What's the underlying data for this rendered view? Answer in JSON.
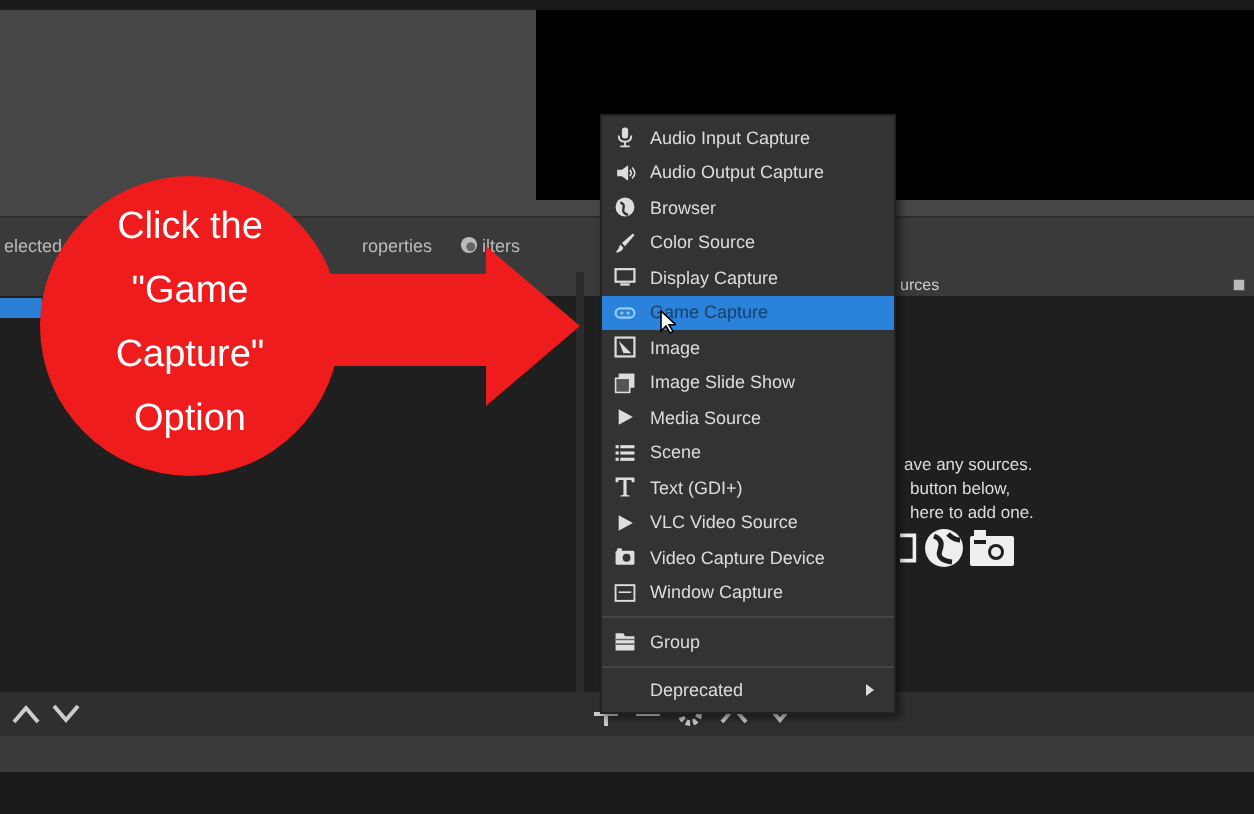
{
  "toolbar": {
    "selection_label": "elected",
    "properties_tab": "roperties",
    "filters_tab": "ilters"
  },
  "scenes": {
    "items": [
      {
        "selected": true
      }
    ]
  },
  "sources": {
    "title": "urces",
    "empty_message": [
      "ave any sources.",
      "button below,",
      "here to add one."
    ]
  },
  "menu": {
    "items": [
      {
        "kind": "item",
        "label": "Audio Input Capture",
        "selected": false
      },
      {
        "kind": "item",
        "label": "Audio Output Capture",
        "selected": false
      },
      {
        "kind": "item",
        "label": "Browser",
        "selected": false
      },
      {
        "kind": "item",
        "label": "Color Source",
        "selected": false
      },
      {
        "kind": "item",
        "label": "Display Capture",
        "selected": false
      },
      {
        "kind": "item",
        "label": "Game Capture",
        "selected": true
      },
      {
        "kind": "item",
        "label": "Image",
        "selected": false
      },
      {
        "kind": "item",
        "label": "Image Slide Show",
        "selected": false
      },
      {
        "kind": "item",
        "label": "Media Source",
        "selected": false
      },
      {
        "kind": "item",
        "label": "Scene",
        "selected": false
      },
      {
        "kind": "item",
        "label": "Text (GDI+)",
        "selected": false
      },
      {
        "kind": "item",
        "label": "VLC Video Source",
        "selected": false
      },
      {
        "kind": "item",
        "label": "Video Capture Device",
        "selected": false
      },
      {
        "kind": "item",
        "label": "Window Capture",
        "selected": false
      },
      {
        "kind": "separator"
      },
      {
        "kind": "item",
        "label": "Group",
        "selected": false
      },
      {
        "kind": "separator"
      },
      {
        "kind": "submenu",
        "label": "Deprecated",
        "selected": false
      }
    ]
  },
  "callout": {
    "text": "Click the \"Game Capture\" Option"
  }
}
